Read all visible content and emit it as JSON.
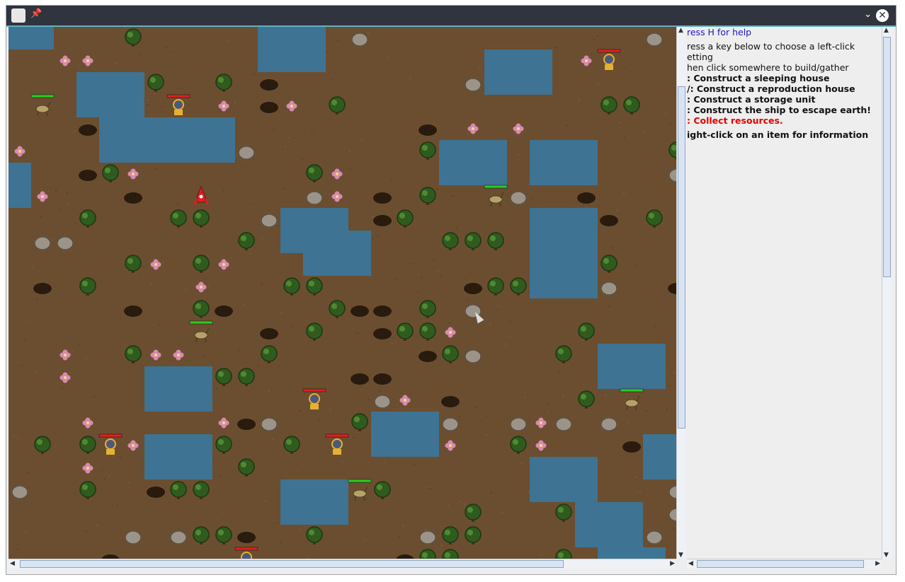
{
  "window": {
    "title": ""
  },
  "info_panel": {
    "lines": [
      {
        "text": "ress H for help",
        "style": "blue"
      },
      {
        "text": "ress a key below to choose a left-click",
        "style": "normal"
      },
      {
        "text": "etting",
        "style": "normal"
      },
      {
        "text": "hen click somewhere to build/gather",
        "style": "normal"
      },
      {
        "text": ": Construct a sleeping house",
        "style": "bold"
      },
      {
        "text": "/: Construct a reproduction house",
        "style": "bold"
      },
      {
        "text": ": Construct a storage unit",
        "style": "bold"
      },
      {
        "text": ": Construct the ship to escape earth!",
        "style": "bold"
      },
      {
        "text": ": Collect resources.",
        "style": "red"
      },
      {
        "text": "ight-click on an item for information",
        "style": "bold"
      }
    ]
  },
  "colors": {
    "ground": "#6b4e2f",
    "water": "#3f7393",
    "tree": "#2f5b1f",
    "rock": "#9c9488",
    "flower": "#d98ab0",
    "hole": "#2a1b0f",
    "health_bar_red": "#e02020",
    "health_bar_green": "#22cc22"
  },
  "map": {
    "tile": 32,
    "cols": 30,
    "rows": 24,
    "water_cells": [
      [
        0,
        0
      ],
      [
        1,
        0
      ],
      [
        11,
        0
      ],
      [
        12,
        0
      ],
      [
        13,
        0
      ],
      [
        11,
        1
      ],
      [
        12,
        1
      ],
      [
        13,
        1
      ],
      [
        21,
        1
      ],
      [
        22,
        1
      ],
      [
        23,
        1
      ],
      [
        3,
        2
      ],
      [
        4,
        2
      ],
      [
        5,
        2
      ],
      [
        21,
        2
      ],
      [
        22,
        2
      ],
      [
        23,
        2
      ],
      [
        3,
        3
      ],
      [
        4,
        3
      ],
      [
        5,
        3
      ],
      [
        4,
        4
      ],
      [
        5,
        4
      ],
      [
        6,
        4
      ],
      [
        7,
        4
      ],
      [
        8,
        4
      ],
      [
        9,
        4
      ],
      [
        4,
        5
      ],
      [
        5,
        5
      ],
      [
        6,
        5
      ],
      [
        7,
        5
      ],
      [
        8,
        5
      ],
      [
        9,
        5
      ],
      [
        19,
        5
      ],
      [
        20,
        5
      ],
      [
        21,
        5
      ],
      [
        23,
        5
      ],
      [
        24,
        5
      ],
      [
        25,
        5
      ],
      [
        0,
        6
      ],
      [
        19,
        6
      ],
      [
        20,
        6
      ],
      [
        21,
        6
      ],
      [
        23,
        6
      ],
      [
        24,
        6
      ],
      [
        25,
        6
      ],
      [
        0,
        7
      ],
      [
        12,
        8
      ],
      [
        13,
        8
      ],
      [
        14,
        8
      ],
      [
        23,
        8
      ],
      [
        24,
        8
      ],
      [
        25,
        8
      ],
      [
        12,
        9
      ],
      [
        13,
        9
      ],
      [
        14,
        9
      ],
      [
        15,
        9
      ],
      [
        23,
        9
      ],
      [
        24,
        9
      ],
      [
        25,
        9
      ],
      [
        13,
        10
      ],
      [
        14,
        10
      ],
      [
        15,
        10
      ],
      [
        23,
        10
      ],
      [
        24,
        10
      ],
      [
        25,
        10
      ],
      [
        23,
        11
      ],
      [
        24,
        11
      ],
      [
        25,
        11
      ],
      [
        26,
        14
      ],
      [
        27,
        14
      ],
      [
        28,
        14
      ],
      [
        6,
        15
      ],
      [
        7,
        15
      ],
      [
        8,
        15
      ],
      [
        26,
        15
      ],
      [
        27,
        15
      ],
      [
        28,
        15
      ],
      [
        6,
        16
      ],
      [
        7,
        16
      ],
      [
        8,
        16
      ],
      [
        16,
        17
      ],
      [
        17,
        17
      ],
      [
        18,
        17
      ],
      [
        16,
        18
      ],
      [
        17,
        18
      ],
      [
        18,
        18
      ],
      [
        6,
        18
      ],
      [
        7,
        18
      ],
      [
        8,
        18
      ],
      [
        28,
        18
      ],
      [
        29,
        18
      ],
      [
        6,
        19
      ],
      [
        7,
        19
      ],
      [
        8,
        19
      ],
      [
        28,
        19
      ],
      [
        29,
        19
      ],
      [
        23,
        19
      ],
      [
        24,
        19
      ],
      [
        25,
        19
      ],
      [
        12,
        20
      ],
      [
        13,
        20
      ],
      [
        14,
        20
      ],
      [
        23,
        20
      ],
      [
        24,
        20
      ],
      [
        25,
        20
      ],
      [
        12,
        21
      ],
      [
        13,
        21
      ],
      [
        14,
        21
      ],
      [
        25,
        21
      ],
      [
        26,
        21
      ],
      [
        27,
        21
      ],
      [
        25,
        22
      ],
      [
        26,
        22
      ],
      [
        27,
        22
      ],
      [
        26,
        23
      ],
      [
        27,
        23
      ],
      [
        28,
        23
      ]
    ],
    "trees": [
      [
        5,
        0
      ],
      [
        6,
        2
      ],
      [
        9,
        2
      ],
      [
        14,
        3
      ],
      [
        26,
        3
      ],
      [
        27,
        3
      ],
      [
        18,
        5
      ],
      [
        29,
        5
      ],
      [
        4,
        6
      ],
      [
        13,
        6
      ],
      [
        18,
        7
      ],
      [
        3,
        8
      ],
      [
        7,
        8
      ],
      [
        8,
        8
      ],
      [
        17,
        8
      ],
      [
        28,
        8
      ],
      [
        10,
        9
      ],
      [
        19,
        9
      ],
      [
        20,
        9
      ],
      [
        21,
        9
      ],
      [
        5,
        10
      ],
      [
        8,
        10
      ],
      [
        26,
        10
      ],
      [
        3,
        11
      ],
      [
        12,
        11
      ],
      [
        13,
        11
      ],
      [
        21,
        11
      ],
      [
        22,
        11
      ],
      [
        8,
        12
      ],
      [
        14,
        12
      ],
      [
        18,
        12
      ],
      [
        13,
        13
      ],
      [
        17,
        13
      ],
      [
        18,
        13
      ],
      [
        25,
        13
      ],
      [
        5,
        14
      ],
      [
        11,
        14
      ],
      [
        19,
        14
      ],
      [
        24,
        14
      ],
      [
        9,
        15
      ],
      [
        10,
        15
      ],
      [
        25,
        16
      ],
      [
        15,
        17
      ],
      [
        1,
        18
      ],
      [
        3,
        18
      ],
      [
        9,
        18
      ],
      [
        12,
        18
      ],
      [
        22,
        18
      ],
      [
        10,
        19
      ],
      [
        3,
        20
      ],
      [
        7,
        20
      ],
      [
        8,
        20
      ],
      [
        16,
        20
      ],
      [
        20,
        21
      ],
      [
        24,
        21
      ],
      [
        8,
        22
      ],
      [
        9,
        22
      ],
      [
        13,
        22
      ],
      [
        19,
        22
      ],
      [
        20,
        22
      ],
      [
        18,
        23
      ],
      [
        19,
        23
      ],
      [
        24,
        23
      ]
    ],
    "rocks": [
      [
        15,
        0
      ],
      [
        28,
        0
      ],
      [
        20,
        2
      ],
      [
        10,
        5
      ],
      [
        29,
        6
      ],
      [
        13,
        7
      ],
      [
        22,
        7
      ],
      [
        11,
        8
      ],
      [
        1,
        9
      ],
      [
        2,
        9
      ],
      [
        26,
        11
      ],
      [
        20,
        12
      ],
      [
        20,
        14
      ],
      [
        16,
        16
      ],
      [
        11,
        17
      ],
      [
        19,
        17
      ],
      [
        22,
        17
      ],
      [
        24,
        17
      ],
      [
        26,
        17
      ],
      [
        0,
        20
      ],
      [
        29,
        20
      ],
      [
        29,
        21
      ],
      [
        5,
        22
      ],
      [
        7,
        22
      ],
      [
        18,
        22
      ],
      [
        28,
        22
      ]
    ],
    "flowers": [
      [
        2,
        1
      ],
      [
        3,
        1
      ],
      [
        25,
        1
      ],
      [
        9,
        3
      ],
      [
        12,
        3
      ],
      [
        20,
        4
      ],
      [
        22,
        4
      ],
      [
        0,
        5
      ],
      [
        5,
        6
      ],
      [
        14,
        6
      ],
      [
        1,
        7
      ],
      [
        14,
        7
      ],
      [
        6,
        10
      ],
      [
        9,
        10
      ],
      [
        8,
        11
      ],
      [
        19,
        13
      ],
      [
        2,
        14
      ],
      [
        6,
        14
      ],
      [
        7,
        14
      ],
      [
        2,
        15
      ],
      [
        17,
        16
      ],
      [
        3,
        17
      ],
      [
        9,
        17
      ],
      [
        23,
        17
      ],
      [
        5,
        18
      ],
      [
        19,
        18
      ],
      [
        23,
        18
      ],
      [
        3,
        19
      ]
    ],
    "holes": [
      [
        11,
        2
      ],
      [
        11,
        3
      ],
      [
        3,
        4
      ],
      [
        18,
        4
      ],
      [
        3,
        6
      ],
      [
        5,
        7
      ],
      [
        16,
        7
      ],
      [
        25,
        7
      ],
      [
        16,
        8
      ],
      [
        26,
        8
      ],
      [
        1,
        11
      ],
      [
        20,
        11
      ],
      [
        5,
        12
      ],
      [
        9,
        12
      ],
      [
        15,
        12
      ],
      [
        16,
        12
      ],
      [
        11,
        13
      ],
      [
        16,
        13
      ],
      [
        18,
        14
      ],
      [
        15,
        15
      ],
      [
        16,
        15
      ],
      [
        19,
        16
      ],
      [
        10,
        17
      ],
      [
        27,
        18
      ],
      [
        6,
        20
      ],
      [
        29,
        11
      ],
      [
        10,
        22
      ],
      [
        4,
        23
      ],
      [
        17,
        23
      ]
    ],
    "rocket": [
      8,
      7
    ],
    "humans": [
      [
        26,
        1
      ],
      [
        7,
        3
      ],
      [
        13,
        16
      ],
      [
        4,
        18
      ],
      [
        14,
        18
      ],
      [
        10,
        23
      ]
    ],
    "deer": [
      [
        1,
        3
      ],
      [
        21,
        7
      ],
      [
        8,
        13
      ],
      [
        27,
        16
      ],
      [
        15,
        20
      ]
    ]
  }
}
